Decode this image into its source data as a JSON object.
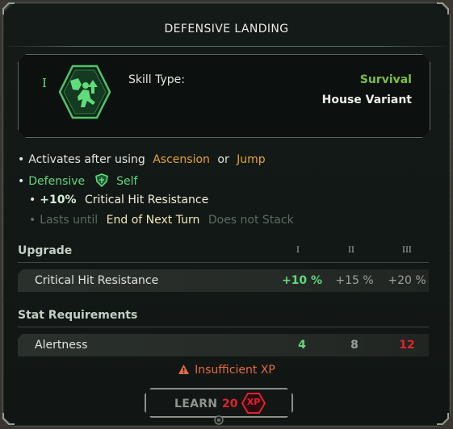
{
  "title": "DEFENSIVE LANDING",
  "skill": {
    "tier": "I",
    "icon": "defensive-landing-icon",
    "type_label": "Skill Type:",
    "type_value": "Survival",
    "variant": "House Variant"
  },
  "description": {
    "line1": {
      "bullet": "•",
      "prefix": "Activates after using",
      "skill_a": "Ascension",
      "conj": "or",
      "skill_b": "Jump"
    },
    "line2": {
      "bullet": "•",
      "effect_type": "Defensive",
      "shield_icon": "defensive-shield-icon",
      "target": "Self"
    },
    "line3": {
      "bullet": "•",
      "value": "+10%",
      "stat": "Critical Hit Resistance"
    },
    "line4": {
      "bullet": "•",
      "prefix": "Lasts until",
      "duration": "End of Next Turn",
      "stack": "Does not Stack"
    }
  },
  "upgrade": {
    "heading": "Upgrade",
    "tiers": [
      "I",
      "II",
      "III"
    ],
    "row": {
      "label": "Critical Hit Resistance",
      "values": [
        "+10 %",
        "+15 %",
        "+20 %"
      ]
    }
  },
  "requirements": {
    "heading": "Stat Requirements",
    "row": {
      "label": "Alertness",
      "values": [
        "4",
        "8",
        "12"
      ]
    }
  },
  "warning": {
    "icon": "warning-icon",
    "text": "Insufficient XP"
  },
  "learn_button": {
    "label": "LEARN",
    "cost": "20",
    "currency": "XP"
  },
  "colors": {
    "accent_green": "#62d87e",
    "survival_green": "#7fbf3e",
    "orange": "#e3a43a",
    "red": "#e0232e",
    "warning": "#e36a42"
  }
}
